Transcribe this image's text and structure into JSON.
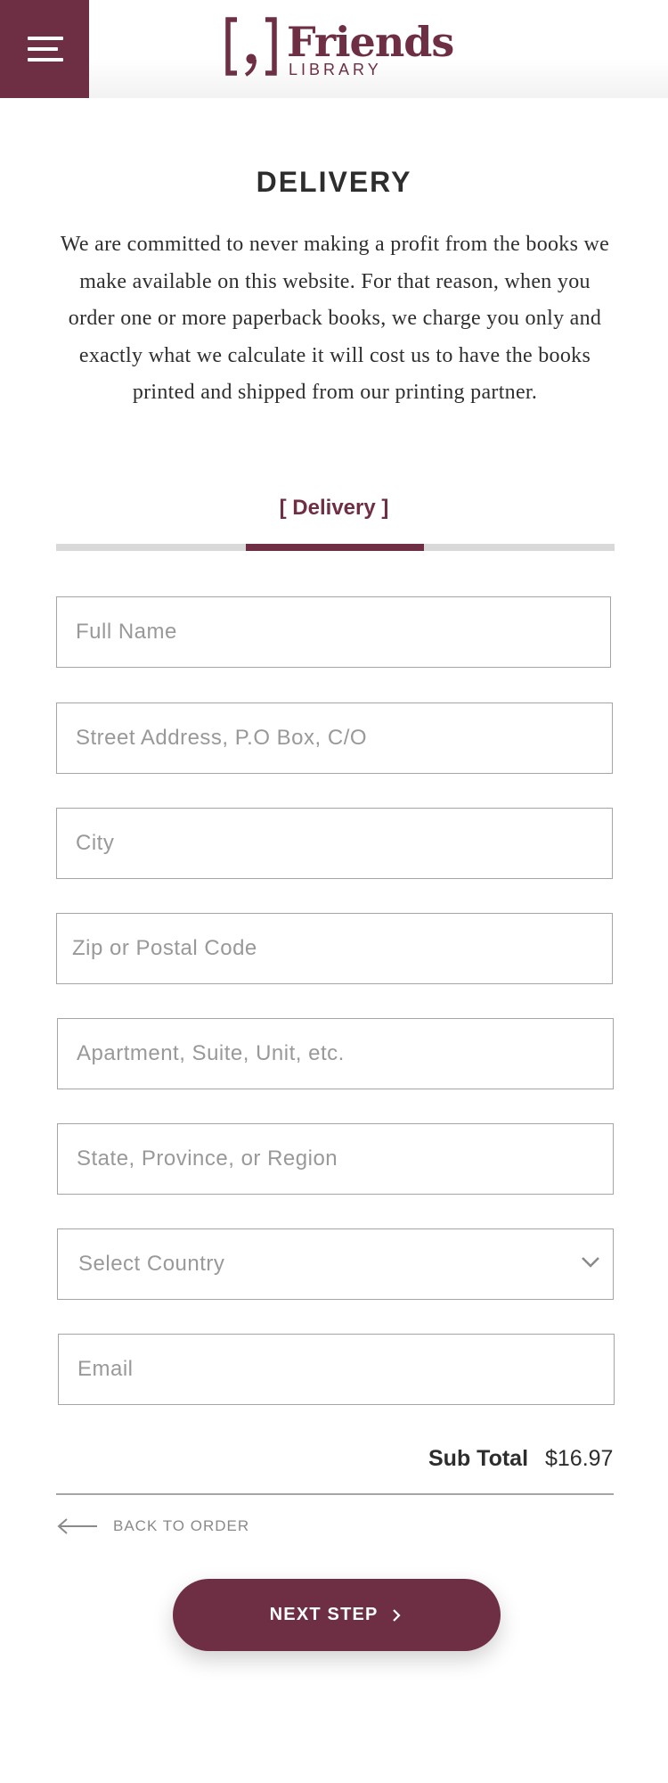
{
  "header": {
    "logo_title": "Friends",
    "logo_subtitle": "LIBRARY",
    "menu_icon": "hamburger-menu-icon",
    "brand_color": "#6e2e44"
  },
  "main": {
    "title": "DELIVERY",
    "intro": "We are committed to never making a profit from the books we make available on this website. For that reason, when you order one or more paperback books, we charge you only and exactly what we calculate it will cost us to have the books printed and shipped from our printing partner.",
    "step_label": "[ Delivery ]",
    "step_progress": {
      "current_step": 2,
      "total_steps": 3
    }
  },
  "form": {
    "full_name": {
      "placeholder": "Full Name",
      "value": ""
    },
    "street": {
      "placeholder": "Street Address, P.O Box, C/O",
      "value": ""
    },
    "city": {
      "placeholder": "City",
      "value": ""
    },
    "zip": {
      "placeholder": "Zip or Postal Code",
      "value": ""
    },
    "apartment": {
      "placeholder": "Apartment, Suite, Unit, etc.",
      "value": ""
    },
    "state": {
      "placeholder": "State, Province, or Region",
      "value": ""
    },
    "country": {
      "selected": "Select Country",
      "icon": "chevron-down-icon"
    },
    "email": {
      "placeholder": "Email",
      "value": ""
    }
  },
  "summary": {
    "subtotal_label": "Sub Total",
    "subtotal_value": "$16.97"
  },
  "nav": {
    "back_label": "BACK TO ORDER",
    "back_icon": "arrow-left-icon",
    "next_label": "NEXT STEP",
    "next_icon": "chevron-right-icon"
  }
}
